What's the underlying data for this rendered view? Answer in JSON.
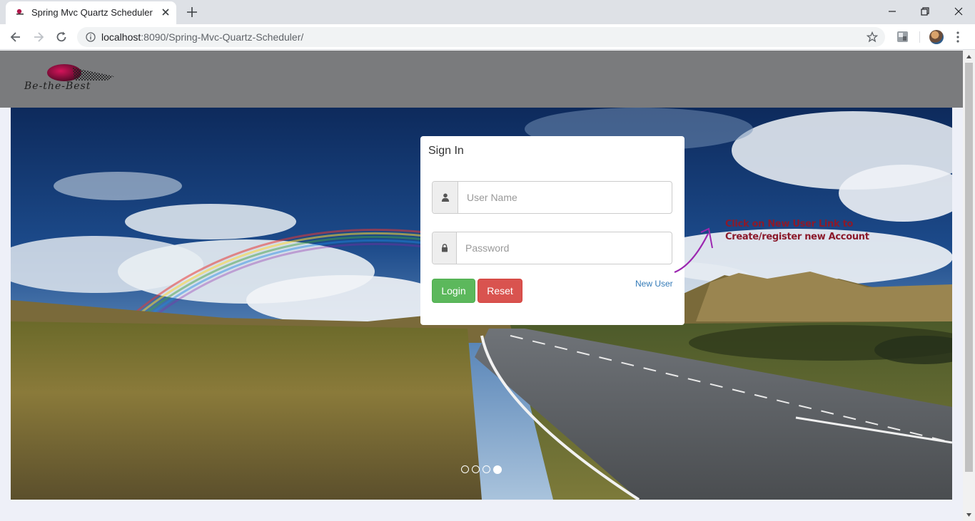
{
  "browser": {
    "tab_title": "Spring Mvc Quartz Scheduler",
    "url_host": "localhost",
    "url_rest": ":8090/Spring-Mvc-Quartz-Scheduler/"
  },
  "header": {
    "logo_text": "Be-the-Best"
  },
  "login": {
    "title": "Sign In",
    "username_placeholder": "User Name",
    "password_placeholder": "Password",
    "login_label": "Login",
    "reset_label": "Reset",
    "new_user_label": "New User",
    "login_color": "#5cb85c",
    "reset_color": "#d9534f",
    "link_color": "#337ab7"
  },
  "annotation": {
    "line1": "Click on New User Link to",
    "line2": "Create/register new Account"
  },
  "carousel": {
    "slides": 4,
    "active": 4
  }
}
